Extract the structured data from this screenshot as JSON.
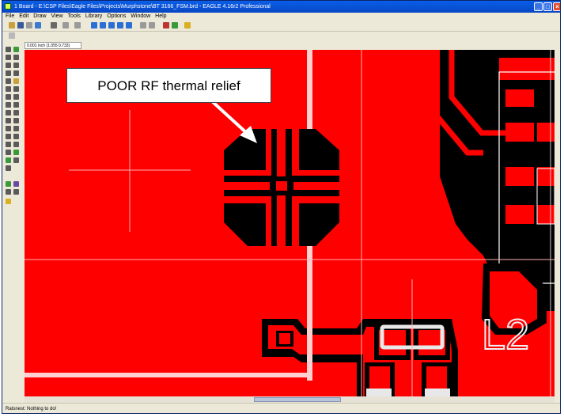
{
  "window": {
    "title": "1 Board - E:\\CSP Files\\Eagle Files\\Projects\\Murphstone\\BT 3166_FSM.brd - EAGLE 4.16r2 Professional"
  },
  "menu": [
    "File",
    "Edit",
    "Draw",
    "View",
    "Tools",
    "Library",
    "Options",
    "Window",
    "Help"
  ],
  "document_tab": {
    "label": "0.001 inch (1.055 0.733)"
  },
  "callout": {
    "text": "POOR RF thermal relief"
  },
  "silkscreen": {
    "label": "L2"
  },
  "status": {
    "text": "Ratsnest: Nothing to do!"
  },
  "icons": [
    "app-icon",
    "minimize-icon",
    "maximize-icon",
    "close-icon"
  ],
  "colors": {
    "copper": "#ff0000",
    "clearance": "#000000",
    "silkscreen": "#e8e8e8",
    "grid": "#ffffff",
    "titlebar": "#0a5ee8"
  }
}
